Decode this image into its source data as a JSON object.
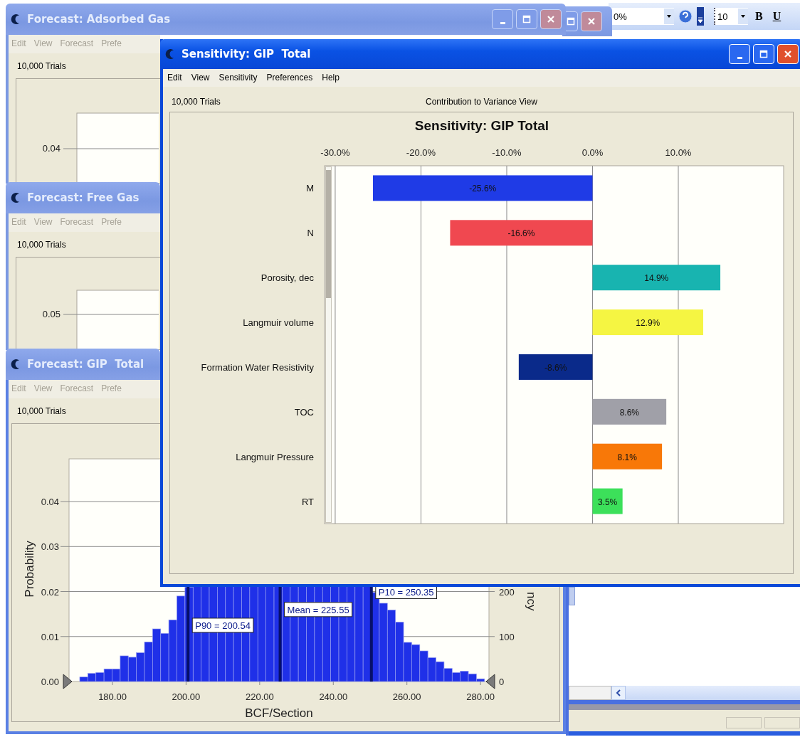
{
  "toolbar": {
    "zoom": "0%",
    "font_size": "10",
    "bold": "B",
    "underline": "U"
  },
  "adsorbed_window": {
    "title": "Forecast: Adsorbed Gas",
    "active": false,
    "menu": [
      "Edit",
      "View",
      "Forecast",
      "Prefe"
    ],
    "trials": "10,000 Trials",
    "y_tick": "0.04"
  },
  "free_gas_window": {
    "title": "Forecast: Free Gas",
    "active": false,
    "menu": [
      "Edit",
      "View",
      "Forecast",
      "Prefe"
    ],
    "trials": "10,000 Trials",
    "y_tick": "0.05"
  },
  "gip_window": {
    "title": "Forecast: GIP  Total",
    "active": false,
    "menu": [
      "Edit",
      "View",
      "Forecast",
      "Prefe"
    ],
    "trials": "10,000 Trials",
    "chart_data": {
      "type": "bar",
      "xlabel": "BCF/Section",
      "ylabel": "Probability",
      "y2label": "ncy",
      "x": [
        172.2,
        174.4,
        176.6,
        178.8,
        181.0,
        183.2,
        185.4,
        187.6,
        189.8,
        192.0,
        194.2,
        196.4,
        198.6,
        200.8,
        203.0,
        205.2,
        207.4,
        209.6,
        211.8,
        214.0,
        216.2,
        218.4,
        220.6,
        222.8,
        225.0,
        227.2,
        229.4,
        231.6,
        233.8,
        236.0,
        238.2,
        240.4,
        242.6,
        244.8,
        247.0,
        249.2,
        251.4,
        253.6,
        255.8,
        258.0,
        260.2,
        262.4,
        264.6,
        266.8,
        269.0,
        271.2,
        273.4,
        275.6,
        277.8,
        280.0
      ],
      "values": [
        0.001,
        0.0018,
        0.002,
        0.0028,
        0.0028,
        0.0057,
        0.0054,
        0.0064,
        0.0088,
        0.0117,
        0.0107,
        0.0137,
        0.019,
        0.021,
        null,
        null,
        null,
        null,
        null,
        null,
        null,
        null,
        null,
        null,
        null,
        null,
        null,
        null,
        null,
        null,
        null,
        null,
        null,
        null,
        null,
        null,
        0.0198,
        0.0174,
        0.0159,
        0.0132,
        0.0087,
        0.0082,
        0.0068,
        0.0053,
        0.0044,
        0.0029,
        0.002,
        0.0023,
        0.0017,
        0.0006
      ],
      "xlim": [
        168.2,
        282.3
      ],
      "ylim": [
        0,
        0.0495
      ],
      "xticks": [
        {
          "value": 180,
          "label": "180.00"
        },
        {
          "value": 200,
          "label": "200.00"
        },
        {
          "value": 220,
          "label": "220.00"
        },
        {
          "value": 240,
          "label": "240.00"
        },
        {
          "value": 260,
          "label": "260.00"
        },
        {
          "value": 280,
          "label": "280.00"
        }
      ],
      "yticks": [
        {
          "value": 0,
          "label": "0.00"
        },
        {
          "value": 0.01,
          "label": "0.01"
        },
        {
          "value": 0.02,
          "label": "0.02"
        },
        {
          "value": 0.03,
          "label": "0.03"
        },
        {
          "value": 0.04,
          "label": "0.04"
        }
      ],
      "y2lim": [
        0,
        495
      ],
      "y2ticks": [
        {
          "value": 200,
          "label": "200"
        },
        {
          "value": 100,
          "label": "100"
        },
        {
          "value": 0,
          "label": "0"
        }
      ],
      "grid": true,
      "ref_lines": [
        {
          "axis": "x",
          "value": 200.54
        },
        {
          "axis": "x",
          "value": 225.55
        },
        {
          "axis": "x",
          "value": 250.35
        }
      ],
      "annotations": [
        {
          "x": 200.54,
          "y": 0.0125,
          "text": "P90 = 200.54"
        },
        {
          "x": 225.55,
          "y": 0.016,
          "text": "Mean = 225.55"
        },
        {
          "x": 250.35,
          "y": 0.02,
          "text": "P10 = 250.35"
        }
      ]
    }
  },
  "sensitivity_window": {
    "title": "Sensitivity: GIP  Total",
    "active": true,
    "menu": [
      "Edit",
      "View",
      "Sensitivity",
      "Preferences",
      "Help"
    ],
    "trials": "10,000 Trials",
    "view": "Contribution to Variance View",
    "chart_data": {
      "type": "bar",
      "orientation": "horizontal",
      "title": "Sensitivity: GIP Total",
      "grid": true,
      "categories": [
        "M",
        "N",
        "Porosity, dec",
        "Langmuir volume",
        "Formation Water Resistivity",
        "TOC",
        "Langmuir Pressure",
        "RT"
      ],
      "series": [
        {
          "values": [
            -25.6,
            -16.6,
            14.9,
            12.9,
            -8.6,
            8.6,
            8.1,
            3.5
          ],
          "colors": [
            "#1f3be6",
            "#f04850",
            "#18b4b0",
            "#f5f542",
            "#0a2a8a",
            "#a0a0a8",
            "#f87808",
            "#3ce05a"
          ]
        }
      ],
      "value_labels": [
        "-25.6%",
        "-16.6%",
        "14.9%",
        "12.9%",
        "-8.6%",
        "8.6%",
        "8.1%",
        "3.5%"
      ],
      "xlim": [
        -31.24,
        22.28
      ],
      "xticks": [
        {
          "value": -30,
          "label": "-30.0%"
        },
        {
          "value": -20,
          "label": "-20.0%"
        },
        {
          "value": -10,
          "label": "-10.0%"
        },
        {
          "value": 0,
          "label": "0.0%"
        },
        {
          "value": 10,
          "label": "10.0%"
        }
      ]
    }
  }
}
